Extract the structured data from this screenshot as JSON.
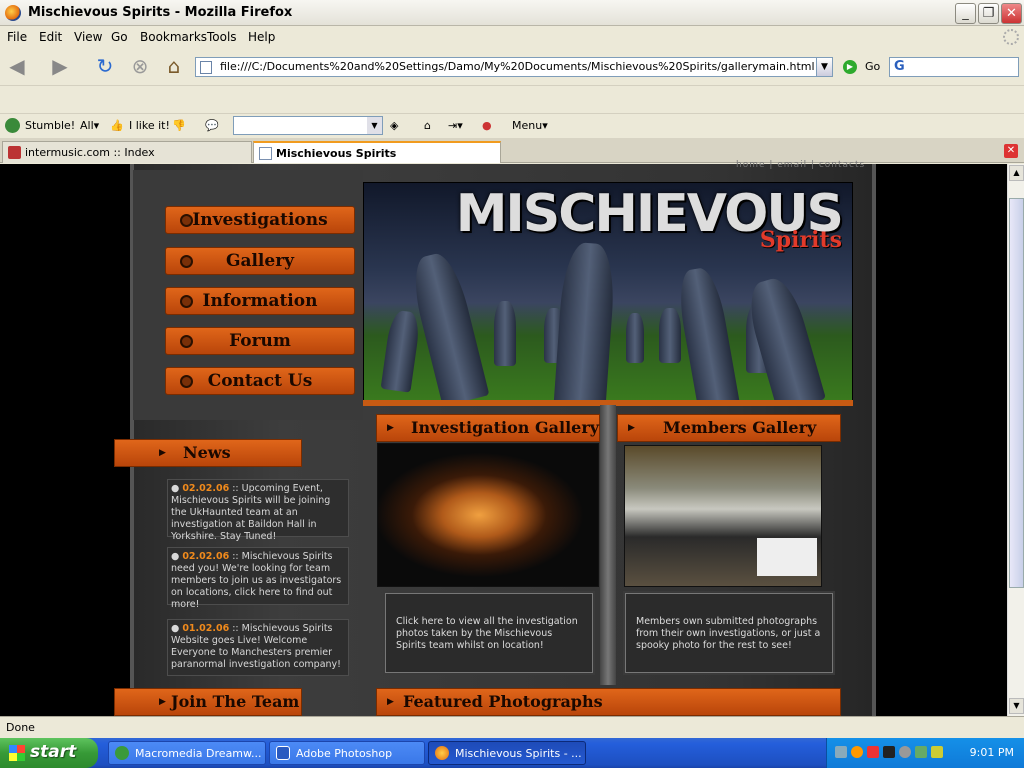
{
  "window": {
    "title": "Mischievous Spirits - Mozilla Firefox"
  },
  "menu": [
    "File",
    "Edit",
    "View",
    "Go",
    "Bookmarks",
    "Tools",
    "Help"
  ],
  "nav": {
    "url": "file:///C:/Documents%20and%20Settings/Damo/My%20Documents/Mischievous%20Spirits/gallerymain.html",
    "go_label": "Go"
  },
  "stumble": {
    "stumble_label": "Stumble!",
    "all_label": "All▾",
    "like_label": "I like it!",
    "menu_label": "Menu▾"
  },
  "tabs": [
    {
      "label": "intermusic.com :: Index"
    },
    {
      "label": "Mischievous Spirits"
    }
  ],
  "site": {
    "top_links": "home  |  email  |  contacts",
    "logo_main": "MISCHIEVOUS",
    "logo_sub": "Spirits",
    "nav_buttons": [
      "Investigations",
      "Gallery",
      "Information",
      "Forum",
      "Contact Us"
    ],
    "news_heading": "News",
    "news": [
      {
        "date": "02.02.06",
        "text": " :: Upcoming Event, Mischievous Spirits will be joining the UkHaunted team at an investigation at Baildon Hall in Yorkshire. Stay Tuned!"
      },
      {
        "date": "02.02.06",
        "text": " :: Mischievous Spirits need you! We're looking for team members to join us as investigators on locations, click here to find out more!"
      },
      {
        "date": "01.02.06",
        "text": " :: Mischievous Spirits Website goes Live! Welcome Everyone to Manchesters premier paranormal investigation company!"
      }
    ],
    "join_team": "Join The Team",
    "investigation_gallery": {
      "heading": "Investigation Gallery",
      "desc": "Click here to view all the investigation photos taken by the Mischievous Spirits team whilst on location!"
    },
    "members_gallery": {
      "heading": "Members Gallery",
      "desc": "Members own submitted photographs from their own investigations, or just a spooky photo for the rest to see!"
    },
    "featured": "Featured Photographs"
  },
  "status": {
    "text": "Done"
  },
  "taskbar": {
    "start_label": "start",
    "items": [
      {
        "label": "Macromedia Dreamw..."
      },
      {
        "label": "Adobe Photoshop"
      },
      {
        "label": "Mischievous Spirits - ..."
      }
    ],
    "clock": "9:01 PM"
  },
  "colors": {
    "accent_orange": "#c65a13",
    "news_date": "#f08a1c",
    "logo_red": "#e23a2a"
  }
}
